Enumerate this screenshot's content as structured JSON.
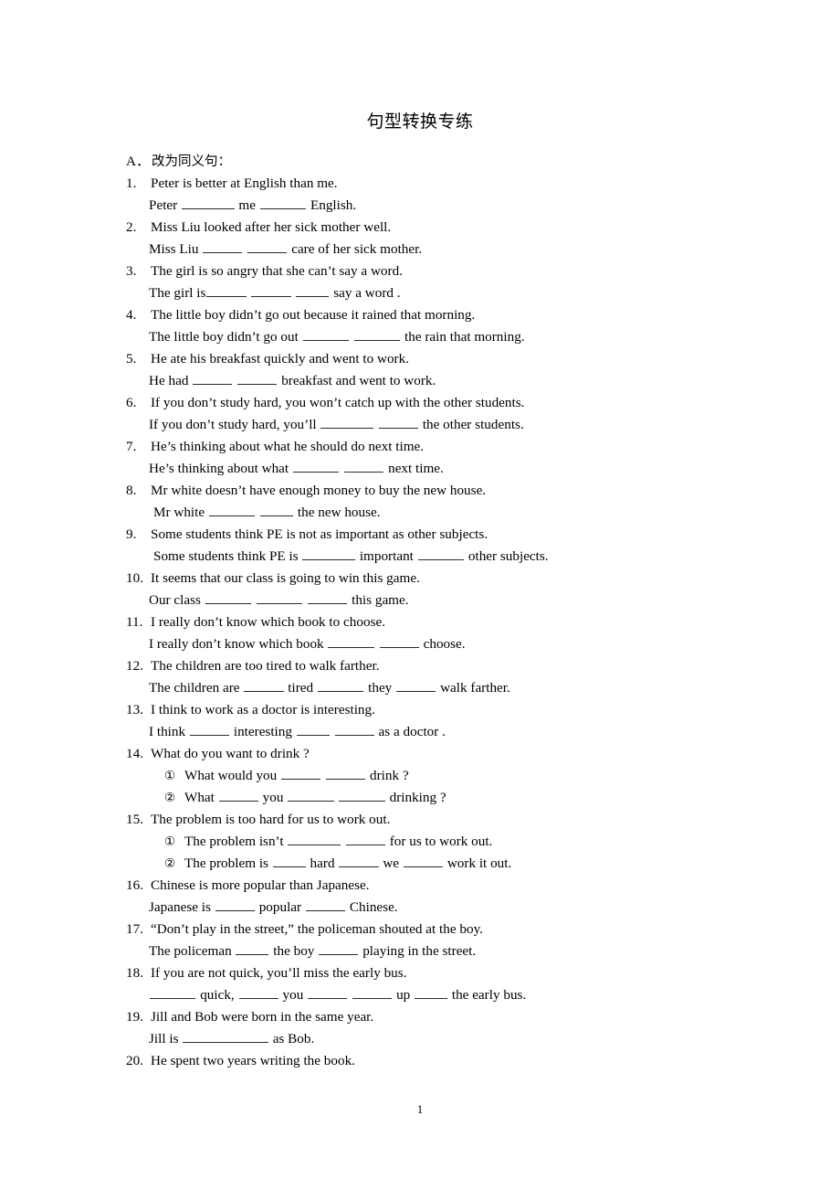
{
  "document": {
    "title": "句型转换专练",
    "page_number": "1"
  },
  "section": {
    "letter": "A．",
    "label": "改为同义句："
  },
  "items": [
    {
      "number": "1.",
      "question": "Peter is better at English than me.",
      "answers": [
        {
          "segments": [
            "Peter ",
            "BLANK8",
            " me ",
            "BLANK7",
            " English."
          ]
        }
      ]
    },
    {
      "number": "2.",
      "question": "Miss Liu looked after her sick mother well.",
      "answers": [
        {
          "segments": [
            "Miss Liu ",
            "BLANK6",
            " ",
            "BLANK6",
            " care of her sick mother."
          ]
        }
      ]
    },
    {
      "number": "3.",
      "question": "The girl is so angry that she can’t say a word.",
      "answers": [
        {
          "segments": [
            "The girl is",
            "BLANK6",
            " ",
            "BLANK6",
            " ",
            "BLANK5",
            " say a word ."
          ]
        }
      ]
    },
    {
      "number": "4.",
      "question": "The little boy didn’t go out because it rained that morning.",
      "answers": [
        {
          "segments": [
            "The little boy didn’t go out ",
            "BLANK7",
            " ",
            "BLANK7",
            " the rain that morning."
          ]
        }
      ]
    },
    {
      "number": "5.",
      "question": "He ate his breakfast quickly and went to work.",
      "answers": [
        {
          "segments": [
            "He had ",
            "BLANK6",
            " ",
            "BLANK6",
            " breakfast and went to work."
          ]
        }
      ]
    },
    {
      "number": "6.",
      "question": "If you don’t study hard, you won’t catch up with the other students.",
      "answers": [
        {
          "segments": [
            "If you don’t study hard, you’ll ",
            "BLANK8",
            " ",
            "BLANK6",
            " the other students."
          ]
        }
      ]
    },
    {
      "number": "7.",
      "question": "He’s thinking about what he should do next time.",
      "answers": [
        {
          "segments": [
            "He’s thinking about what ",
            "BLANK7",
            " ",
            "BLANK6",
            " next time."
          ]
        }
      ]
    },
    {
      "number": "8.",
      "question": "Mr white doesn’t have enough money to buy the new house.",
      "answers": [
        {
          "segments": [
            "Mr white ",
            "BLANK7",
            " ",
            "BLANK5",
            " the new house."
          ],
          "wide": true
        }
      ]
    },
    {
      "number": "9.",
      "question": "Some students think PE is not as important as other subjects.",
      "answers": [
        {
          "segments": [
            "Some students think PE is ",
            "BLANK8",
            " important ",
            "BLANK7",
            " other subjects."
          ],
          "wide": true
        }
      ]
    },
    {
      "number": "10.",
      "question": "It seems that our class is going to win this game.",
      "answers": [
        {
          "segments": [
            "Our class ",
            "BLANK7",
            " ",
            "BLANK7",
            " ",
            "BLANK6",
            " this game."
          ]
        }
      ]
    },
    {
      "number": "11.",
      "question": "I really don’t know which book to choose.",
      "answers": [
        {
          "segments": [
            "I really don’t know which book ",
            "BLANK7",
            " ",
            "BLANK6",
            " choose."
          ]
        }
      ]
    },
    {
      "number": "12.",
      "question": "The children are too tired to walk farther.",
      "answers": [
        {
          "segments": [
            "The children are ",
            "BLANK6",
            " tired ",
            "BLANK7",
            " they ",
            "BLANK6",
            " walk farther."
          ]
        }
      ]
    },
    {
      "number": "13.",
      "question": "I think to work as a doctor is interesting.",
      "answers": [
        {
          "segments": [
            "I think ",
            "BLANK6",
            " interesting ",
            "BLANK5",
            " ",
            "BLANK6",
            " as a doctor ."
          ]
        }
      ]
    },
    {
      "number": "14.",
      "question": "What do you want to drink ?",
      "sub_answers": [
        {
          "mark": "①",
          "segments": [
            "What would you ",
            "BLANK6",
            " ",
            "BLANK6",
            " drink ?"
          ]
        },
        {
          "mark": "②",
          "segments": [
            "What ",
            "BLANK6",
            " you ",
            "BLANK7",
            " ",
            "BLANK7",
            " drinking ?"
          ]
        }
      ]
    },
    {
      "number": "15.",
      "question": "The problem is too hard for us to work out.",
      "sub_answers": [
        {
          "mark": "①",
          "segments": [
            "The problem isn’t ",
            "BLANK8",
            " ",
            "BLANK6",
            " for us to work out."
          ]
        },
        {
          "mark": "②",
          "segments": [
            "The problem is ",
            "BLANK5",
            " hard ",
            "BLANK6",
            " we ",
            "BLANK6",
            " work it out."
          ]
        }
      ]
    },
    {
      "number": "16.",
      "question": "Chinese is more popular than Japanese.",
      "answers": [
        {
          "segments": [
            "Japanese is ",
            "BLANK6",
            " popular ",
            "BLANK6",
            " Chinese."
          ]
        }
      ]
    },
    {
      "number": "17.",
      "question": "“Don’t play in the street,” the policeman shouted at the boy.",
      "answers": [
        {
          "segments": [
            "The policeman ",
            "BLANK5",
            " the boy ",
            "BLANK6",
            " playing in the street."
          ]
        }
      ]
    },
    {
      "number": "18.",
      "question": "If you are not quick, you’ll miss the early bus.",
      "answers": [
        {
          "segments": [
            "BLANK7",
            " quick, ",
            "BLANK6",
            " you ",
            "BLANK6",
            " ",
            "BLANK6",
            " up ",
            "BLANK5",
            " the early bus."
          ]
        }
      ]
    },
    {
      "number": "19.",
      "question": "Jill and Bob were born in the same year.",
      "answers": [
        {
          "segments": [
            "Jill is ",
            "BLANK13",
            " as Bob."
          ]
        }
      ]
    },
    {
      "number": "20.",
      "question": "He spent two years writing the book.",
      "answers": []
    }
  ]
}
